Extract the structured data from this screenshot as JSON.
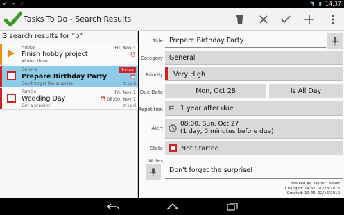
{
  "status_bar": {
    "time": "14:37"
  },
  "action_bar": {
    "title": "Tasks To Do - Search Results"
  },
  "search": {
    "header": "3 search results for \"p\""
  },
  "tasks": [
    {
      "category": "Hobby",
      "title": "Finish hobby project",
      "note": "Almost done...",
      "date": "Fri, Nov 1",
      "due": "",
      "recurrence": "",
      "stripe_color": "#f08c10"
    },
    {
      "category": "General",
      "title": "Prepare Birthday Party",
      "note": "Don't forget the surprise!",
      "date": "Today",
      "due": "",
      "recurrence": "1y d",
      "stripe_color": "#c22"
    },
    {
      "category": "Familie",
      "title": "Wedding Day",
      "note": "Get a present!",
      "date": "Fri, Nov 1",
      "due": "08:00, Nov 1",
      "recurrence": "1y d",
      "stripe_color": "#c22"
    }
  ],
  "detail": {
    "labels": {
      "title": "Title",
      "category": "Category",
      "priority": "Priority",
      "due_date": "Due Date",
      "repetition": "Repetition",
      "alert": "Alert",
      "state": "State",
      "notes": "Notes"
    },
    "title": "Prepare Birthday Party",
    "category": "General",
    "priority": "Very High",
    "due_date": "Mon, Oct 28",
    "all_day": "Is All Day",
    "repetition": "1 year after due",
    "alert_line1": "08:00, Sun, Oct 27",
    "alert_line2": "(1 day, 0 minutes before due)",
    "state": "Not Started",
    "notes": "Don't forget the surprise!",
    "marked_as": "Marked As \"Done\": Never",
    "changed": "Changed: 14:37, 10/28/2013",
    "created": "Created: 19:45, 12/16/2010"
  },
  "colors": {
    "accent": "#8ecbe8",
    "priority": "#c22",
    "play": "#f08c10",
    "today": "#d0202a"
  }
}
